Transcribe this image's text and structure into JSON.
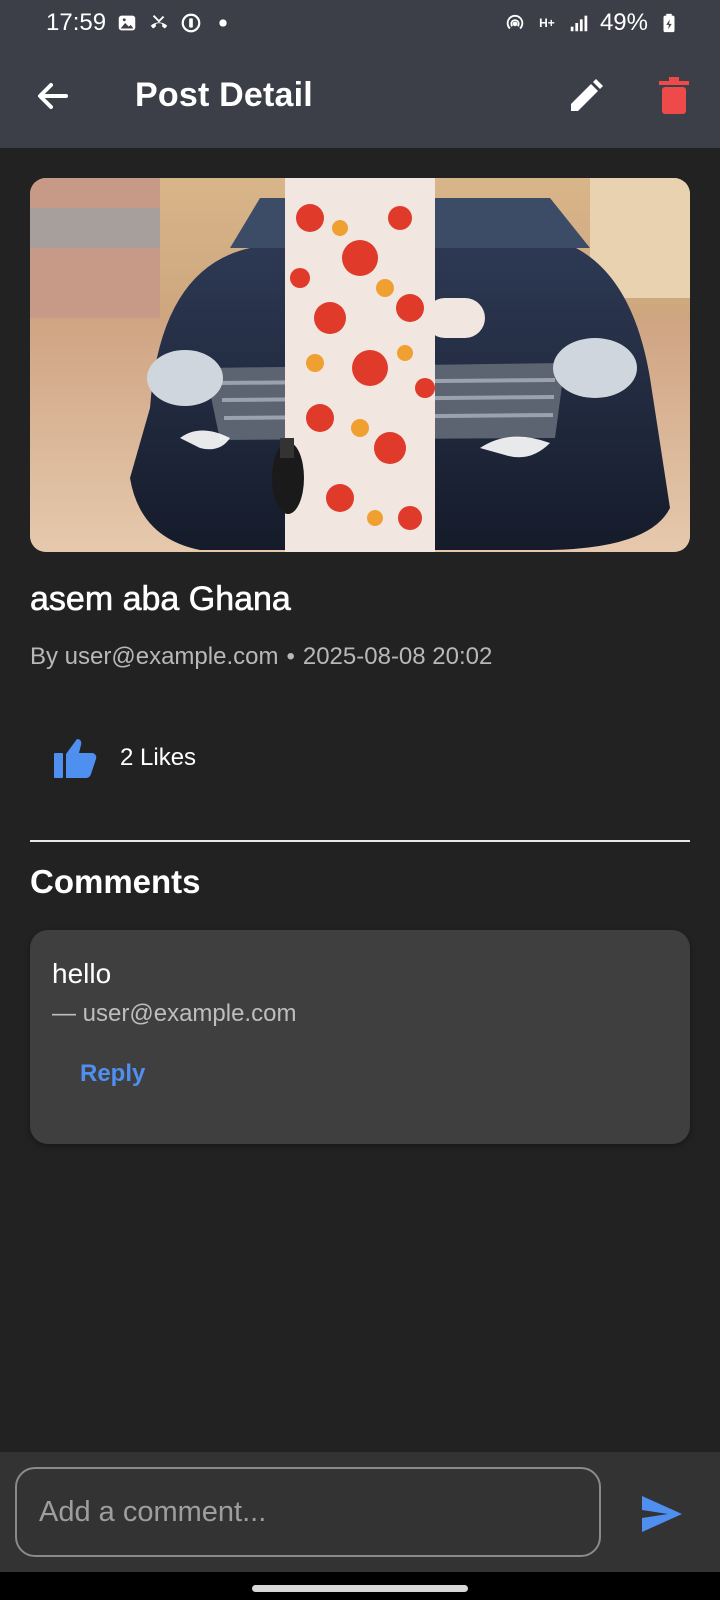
{
  "status_bar": {
    "time": "17:59",
    "left_icons": [
      "gallery-icon",
      "missed-call-icon",
      "timer-icon",
      "dot-icon"
    ],
    "right_icons": [
      "hotspot-icon",
      "network-type-icon",
      "signal-icon",
      "battery-icon"
    ],
    "network_label": "H+",
    "battery": "49%"
  },
  "app_bar": {
    "title": "Post Detail",
    "back_icon": "arrow-back-icon",
    "edit_icon": "pencil-icon",
    "delete_icon": "trash-icon",
    "delete_color": "#ef4a4a"
  },
  "post": {
    "title": "asem aba Ghana",
    "author": "By user@example.com",
    "separator": "•",
    "timestamp": "2025-08-08 20:02",
    "likes_label": "2 Likes",
    "like_icon": "thumb-up-icon",
    "like_color": "#4f8ff0"
  },
  "comments": {
    "heading": "Comments",
    "items": [
      {
        "text": "hello",
        "author": "— user@example.com",
        "reply_label": "Reply"
      }
    ]
  },
  "composer": {
    "placeholder": "Add a comment...",
    "value": "",
    "send_icon": "send-icon",
    "accent": "#4f8ff0"
  }
}
